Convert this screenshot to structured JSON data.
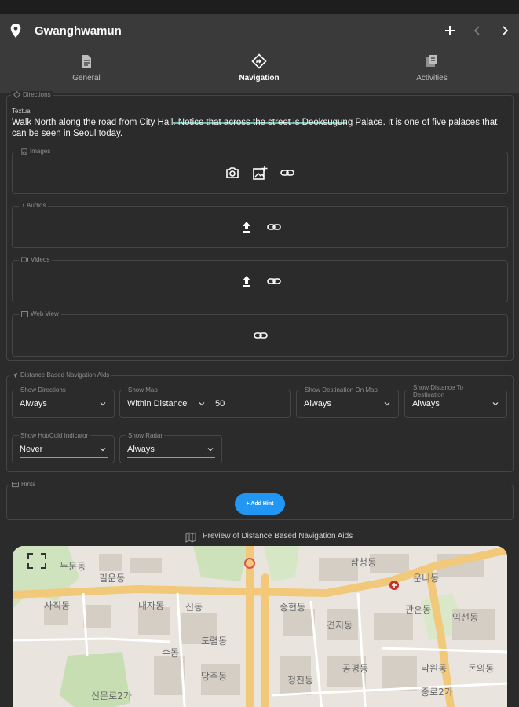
{
  "app": {
    "title": "Gwanghwamun",
    "toolbar": {
      "add_icon": "plus-icon",
      "prev_icon": "chevron-left-icon",
      "next_icon": "chevron-right-icon"
    },
    "accent": "#5fb8a8"
  },
  "tabs": [
    {
      "label": "General",
      "icon": "document-icon"
    },
    {
      "label": "Navigation",
      "icon": "directions-icon",
      "active": true
    },
    {
      "label": "Activities",
      "icon": "activities-icon"
    }
  ],
  "directions": {
    "section_label": "Directions",
    "textual_label": "Textual",
    "textual_value": "Walk North along the road from City Hall.  Notice that across the street is Deoksugung Palace.  It is one of five palaces that can be seen in Seoul today.",
    "images_label": "Images",
    "audios_label": "Audios",
    "videos_label": "Videos",
    "webview_label": "Web View"
  },
  "nav_aids": {
    "section_label": "Distance Based Navigation Aids",
    "show_directions": {
      "label": "Show Directions",
      "value": "Always"
    },
    "show_map": {
      "label": "Show Map",
      "value": "Within Distance",
      "distance": "50"
    },
    "show_destination": {
      "label": "Show Destination On Map",
      "value": "Always"
    },
    "show_distance": {
      "label": "Show Distance To Destination",
      "value": "Always"
    },
    "show_hotcold": {
      "label": "Show Hot/Cold Indicator",
      "value": "Never"
    },
    "show_radar": {
      "label": "Show Radar",
      "value": "Always"
    }
  },
  "hints": {
    "section_label": "Hints",
    "add_button": "+  Add Hint",
    "button_color": "#2196f3"
  },
  "preview": {
    "title": "Preview of Distance Based Navigation Aids"
  }
}
